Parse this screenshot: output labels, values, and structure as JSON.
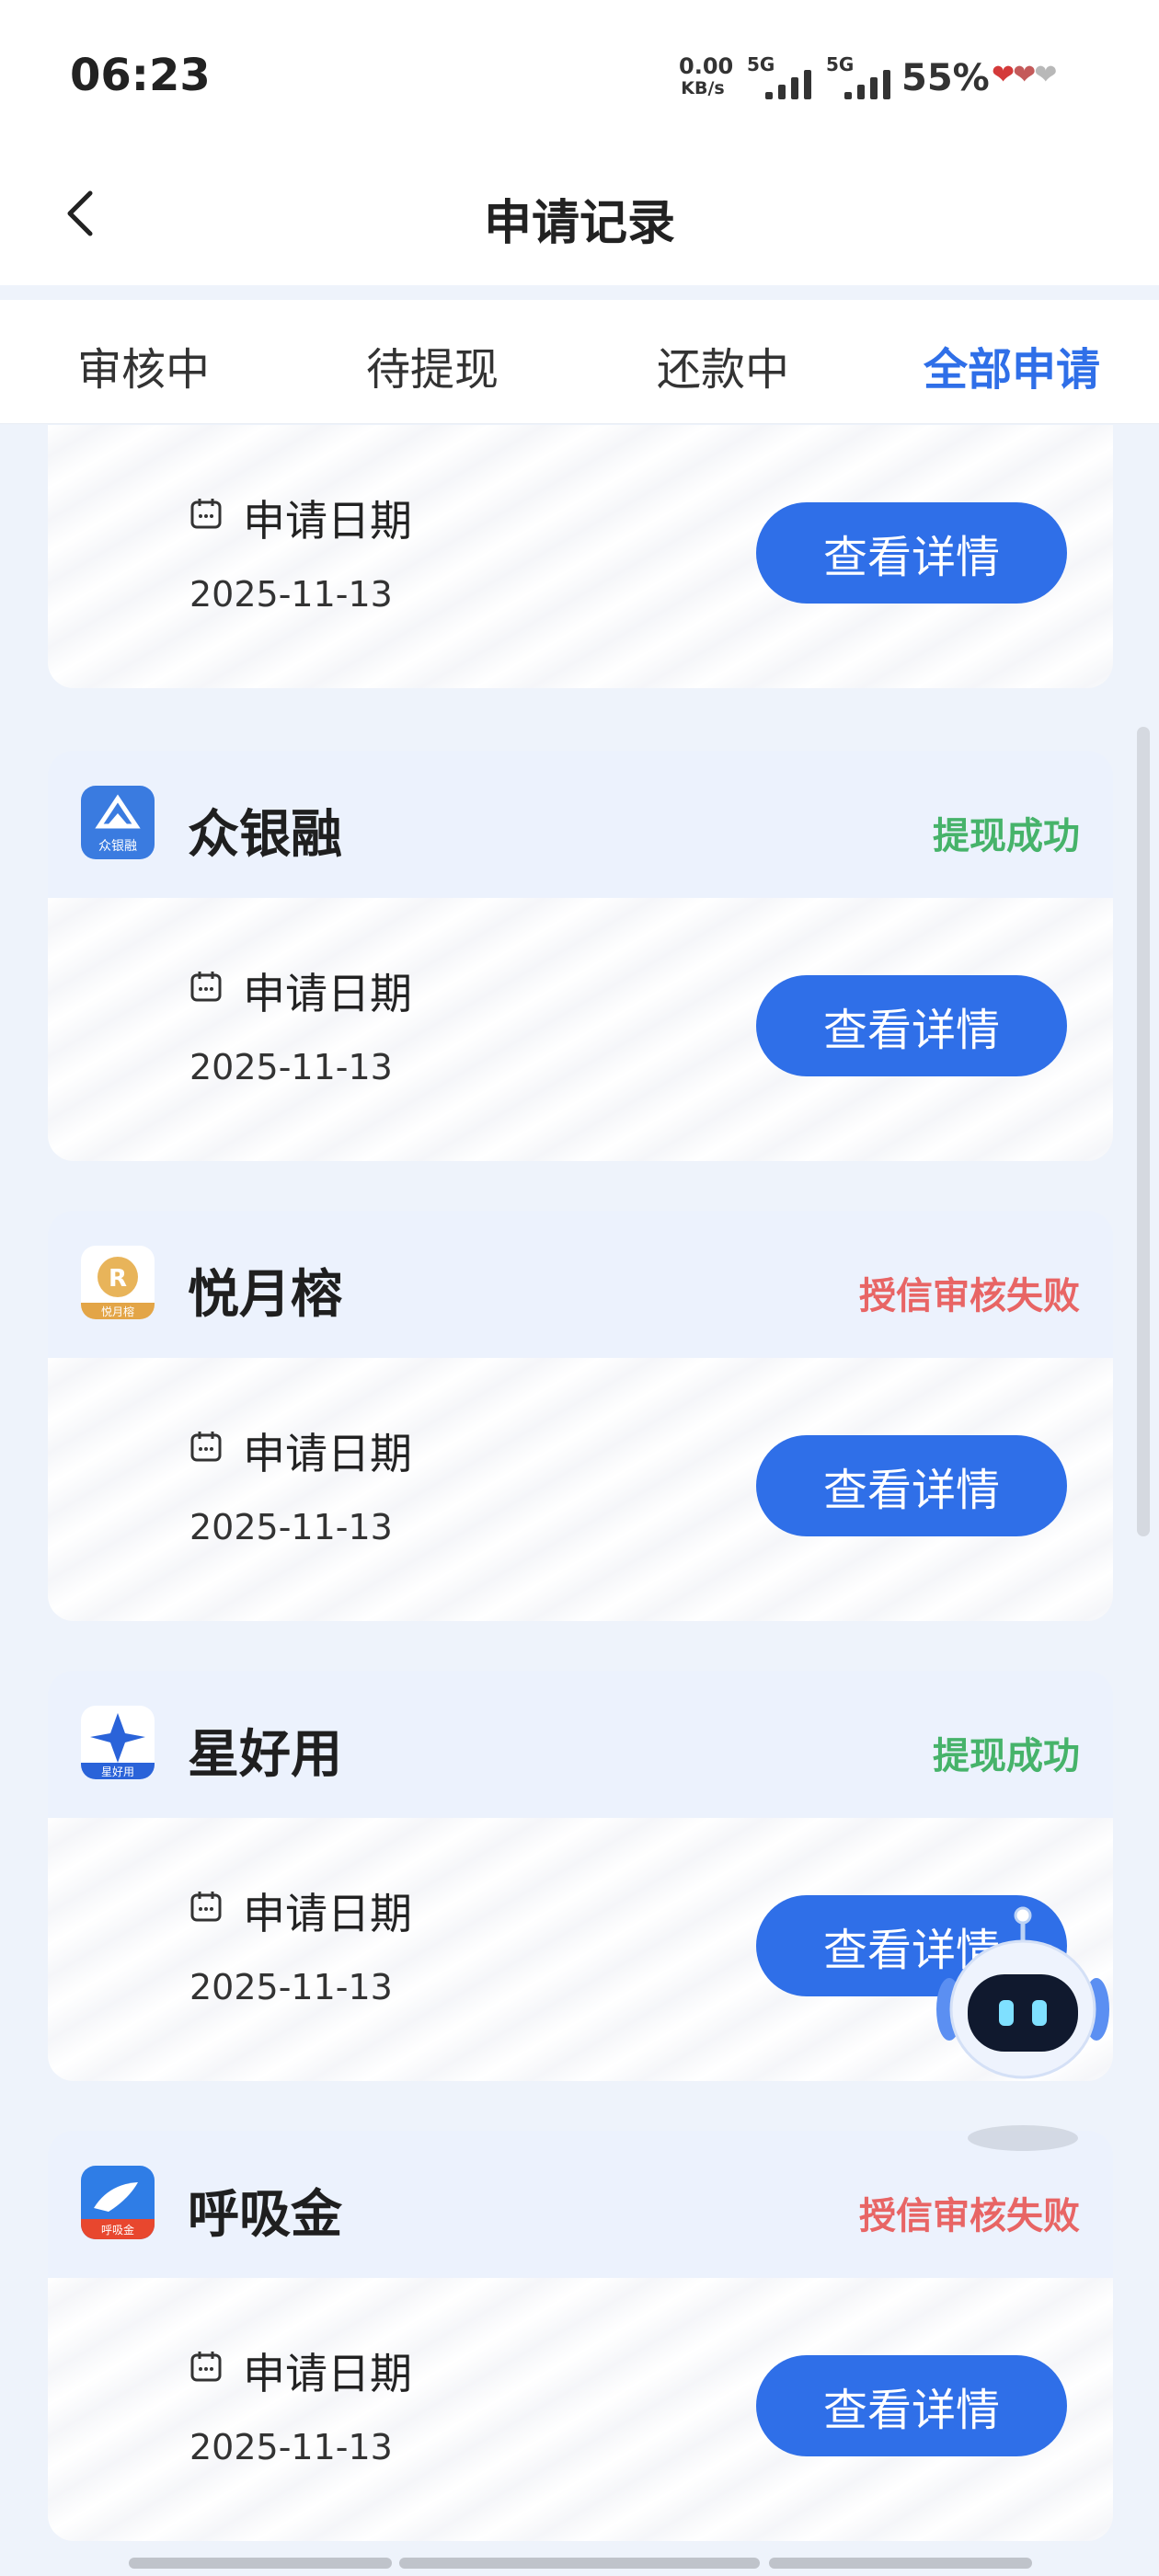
{
  "status_bar": {
    "time": "06:23",
    "net_speed_value": "0.00",
    "net_speed_unit": "KB/s",
    "sim1_label": "5G",
    "sim2_label": "5G",
    "battery": "55%"
  },
  "nav": {
    "title": "申请记录",
    "back_icon": "chevron-left-icon"
  },
  "tabs": [
    {
      "label": "审核中",
      "active": false
    },
    {
      "label": "待提现",
      "active": false
    },
    {
      "label": "还款中",
      "active": false
    },
    {
      "label": "全部申请",
      "active": true
    }
  ],
  "colors": {
    "accent": "#2f6fe8",
    "status_success": "#46b36a",
    "status_fail": "#e86565"
  },
  "records": [
    {
      "name": "",
      "status": "",
      "date_label": "申请日期",
      "date": "2025-11-13",
      "button": "查看详情"
    },
    {
      "name": "众银融",
      "status": "提现成功",
      "status_type": "ok",
      "logo": "zhongyinrong-logo",
      "logo_text": "众银融",
      "date_label": "申请日期",
      "date": "2025-11-13",
      "button": "查看详情"
    },
    {
      "name": "悦月榕",
      "status": "授信审核失败",
      "status_type": "fail",
      "logo": "yueyuerong-logo",
      "logo_text": "悦月榕",
      "date_label": "申请日期",
      "date": "2025-11-13",
      "button": "查看详情"
    },
    {
      "name": "星好用",
      "status": "提现成功",
      "status_type": "ok",
      "logo": "xinghaoyong-logo",
      "logo_text": "星好用",
      "date_label": "申请日期",
      "date": "2025-11-13",
      "button": "查看详情"
    },
    {
      "name": "呼吸金",
      "status": "授信审核失败",
      "status_type": "fail",
      "logo": "huxijin-logo",
      "logo_text": "呼吸金",
      "date_label": "申请日期",
      "date": "2025-11-13",
      "button": "查看详情"
    }
  ],
  "assistant": {
    "icon": "robot-assistant-icon"
  }
}
